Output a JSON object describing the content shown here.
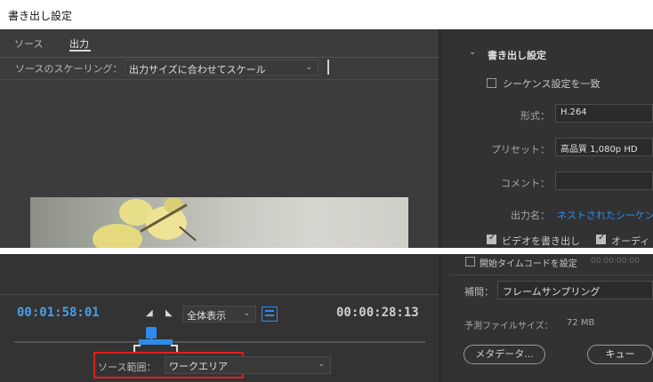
{
  "window": {
    "title": "書き出し設定"
  },
  "tabs": [
    {
      "label": "ソース",
      "active": false
    },
    {
      "label": "出力",
      "active": true
    }
  ],
  "scaling": {
    "label": "ソースのスケーリング：",
    "value": "出力サイズに合わせてスケール"
  },
  "export_settings": {
    "section_title": "書き出し設定",
    "match_sequence": {
      "label": "シーケンス設定を一致",
      "checked": false
    },
    "format": {
      "label": "形式：",
      "value": "H.264"
    },
    "preset": {
      "label": "プリセット：",
      "value": "高品質 1,080p HD"
    },
    "comment": {
      "label": "コメント：",
      "value": ""
    },
    "output_name": {
      "label": "出力名：",
      "value": "ネストされたシーケン"
    },
    "export_video": {
      "label": "ビデオを書き出し",
      "checked": true
    },
    "export_audio": {
      "label": "オーディ",
      "checked": true
    }
  },
  "timeline": {
    "current_time": "00:01:58:01",
    "zoom_label": "全体表示",
    "duration": "00:00:28:13",
    "source_range_label": "ソース範囲：",
    "source_range_value": "ワークエリア"
  },
  "bottom_right": {
    "start_timecode": {
      "label": "開始タイムコードを設定",
      "value": "00:00:00:00",
      "checked": false
    },
    "interpolation": {
      "label": "補間：",
      "value": "フレームサンプリング"
    },
    "estimated_size": {
      "label": "予測ファイルサイズ：",
      "value": "72 MB"
    },
    "metadata_button": "メタデータ...",
    "queue_button": "キュー"
  },
  "colors": {
    "accent_blue": "#2d8ceb",
    "timecode_blue": "#4a9ee8",
    "highlight_red": "#e0201f"
  }
}
